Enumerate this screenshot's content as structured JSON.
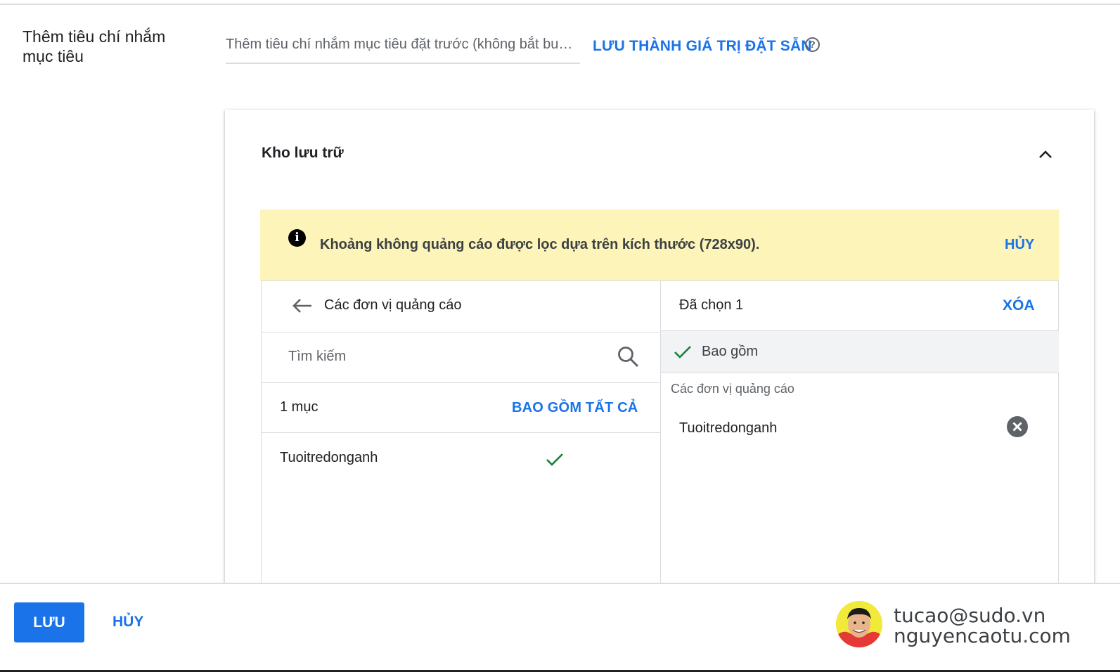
{
  "targeting": {
    "label": "Thêm tiêu chí nhắm mục tiêu",
    "preset_placeholder": "Thêm tiêu chí nhắm mục tiêu đặt trước (không bắt bu…",
    "save_preset_label": "LƯU THÀNH GIÁ TRỊ ĐẶT SẴN",
    "help_icon": "?"
  },
  "inventory": {
    "title": "Kho lưu trữ",
    "banner": {
      "icon": "info-icon",
      "text": "Khoảng không quảng cáo được lọc dựa trên kích thước (728x90).",
      "dismiss_label": "HỦY",
      "background": "#fcf4b9"
    },
    "left_pane": {
      "back_icon": "arrow-left-icon",
      "title": "Các đơn vị quảng cáo",
      "search_placeholder": "Tìm kiếm",
      "count_text": "1 mục",
      "include_all_label": "BAO GỒM TẤT CẢ",
      "items": [
        {
          "name": "Tuoitredonganh",
          "included": true
        }
      ]
    },
    "right_pane": {
      "selected_text": "Đã chọn 1",
      "clear_label": "XÓA",
      "include_label": "Bao gồm",
      "group_label": "Các đơn vị quảng cáo",
      "selected_items": [
        {
          "name": "Tuoitredonganh"
        }
      ]
    }
  },
  "footer": {
    "save_label": "LƯU",
    "cancel_label": "HỦY"
  },
  "watermark": {
    "email": "tucao@sudo.vn",
    "site": "nguyencaotu.com"
  },
  "colors": {
    "accent": "#1a73e8",
    "check_green": "#188038"
  }
}
